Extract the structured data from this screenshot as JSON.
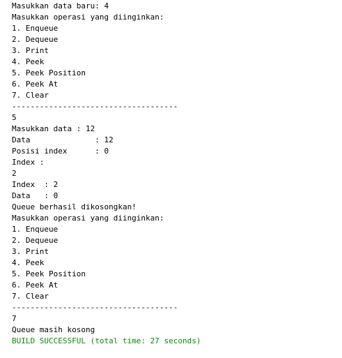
{
  "console": {
    "lines": [
      {
        "text": "Masukkan data baru: 4",
        "type": "output"
      },
      {
        "text": "Masukkan operasi yang diinginkan:",
        "type": "output"
      },
      {
        "text": "1. Enqueue",
        "type": "output"
      },
      {
        "text": "2. Dequeue",
        "type": "output"
      },
      {
        "text": "3. Print",
        "type": "output"
      },
      {
        "text": "4. Peek",
        "type": "output"
      },
      {
        "text": "5. Peek Position",
        "type": "output"
      },
      {
        "text": "6. Peek At",
        "type": "output"
      },
      {
        "text": "7. Clear",
        "type": "output"
      },
      {
        "text": "------------------------------------",
        "type": "output"
      },
      {
        "text": "5",
        "type": "input"
      },
      {
        "text": "Masukkan data : 12",
        "type": "output"
      },
      {
        "text": "Data              : 12",
        "type": "output"
      },
      {
        "text": "Posisi index      : 0",
        "type": "output"
      },
      {
        "text": "Index :",
        "type": "output"
      },
      {
        "text": "2",
        "type": "input"
      },
      {
        "text": "Index  : 2",
        "type": "output"
      },
      {
        "text": "Data   : 0",
        "type": "output"
      },
      {
        "text": "Queue berhasil dikosongkan!",
        "type": "output"
      },
      {
        "text": "Masukkan operasi yang diinginkan:",
        "type": "output"
      },
      {
        "text": "1. Enqueue",
        "type": "output"
      },
      {
        "text": "2. Dequeue",
        "type": "output"
      },
      {
        "text": "3. Print",
        "type": "output"
      },
      {
        "text": "4. Peek",
        "type": "output"
      },
      {
        "text": "5. Peek Position",
        "type": "output"
      },
      {
        "text": "6. Peek At",
        "type": "output"
      },
      {
        "text": "7. Clear",
        "type": "output"
      },
      {
        "text": "------------------------------------",
        "type": "output"
      },
      {
        "text": "7",
        "type": "input"
      },
      {
        "text": "Queue masih kosong",
        "type": "output"
      },
      {
        "text": "BUILD SUCCESSFUL (total time: 27 seconds)",
        "type": "success"
      }
    ]
  },
  "colors": {
    "background": "#ffffff",
    "text": "#000000",
    "success": "#0a8a0a"
  }
}
